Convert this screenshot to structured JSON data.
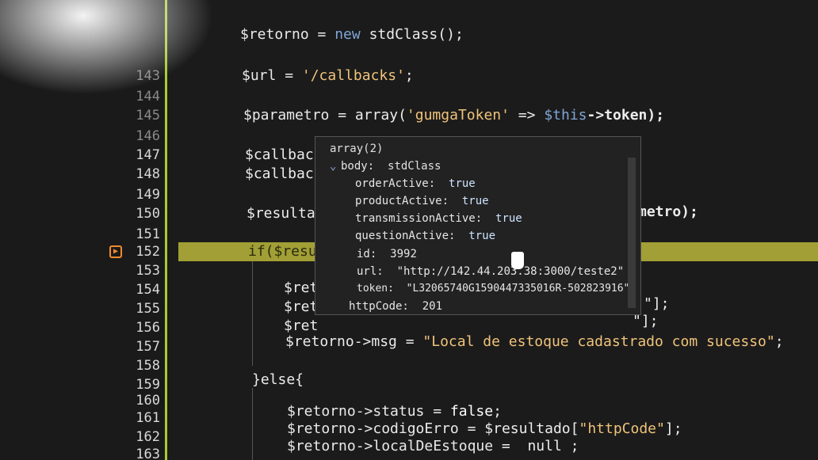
{
  "gutter": {
    "line_numbers": [
      "143",
      "144",
      "145",
      "146",
      "147",
      "148",
      "149",
      "150",
      "151",
      "152",
      "153",
      "154",
      "155",
      "156",
      "157",
      "158",
      "159",
      "160",
      "161",
      "162",
      "163"
    ]
  },
  "code": {
    "l_retorno_new": {
      "var": "$retorno",
      "op": " = ",
      "kw": "new",
      "rest": " stdClass();"
    },
    "l_url": {
      "var": "$url",
      "op": " = ",
      "str": "'/callbacks'",
      "end": ";"
    },
    "l_param": {
      "var": "$parametro",
      "op": " = ",
      "fn": "array(",
      "str": "'gumgaToken'",
      "arrow": " => ",
      "this": "$this",
      "prop": "->token);"
    },
    "l_callback1": "$callbac",
    "l_callback2": "$callbac",
    "l_resulta": "$resulta",
    "l_resulta_tail": "metro);",
    "l_if": "if($resu",
    "l_ret1": "$ret",
    "l_ret2": "$ret",
    "l_ret2_tail": "\"];",
    "l_ret3": "$ret",
    "l_ret3_tail": "\"];",
    "l_msg": {
      "var": "$retorno->msg",
      "op": " = ",
      "str": "\"Local de estoque cadastrado com sucesso\"",
      "end": ";"
    },
    "l_else": "}else{",
    "l_status": {
      "var": "$retorno->status",
      "op": " = ",
      "bool": "false",
      "end": ";"
    },
    "l_codigo": {
      "var": "$retorno->codigoErro",
      "op": " = ",
      "rest": "$resultado[",
      "str": "\"httpCode\"",
      "end": "];"
    },
    "l_local": {
      "var": "$retorno->localDeEstoque",
      "op": " =  ",
      "rest": "null ;"
    }
  },
  "tooltip": {
    "header": "array(2)",
    "body_key": "body:",
    "body_type": "stdClass",
    "props": [
      {
        "key": "orderActive:",
        "val": "true"
      },
      {
        "key": "productActive:",
        "val": "true"
      },
      {
        "key": "transmissionActive:",
        "val": "true"
      },
      {
        "key": "questionActive:",
        "val": "true"
      },
      {
        "key": "id:",
        "val": "3992"
      },
      {
        "key": "url:",
        "val": "\"http://142.44.203.38:3000/teste2\""
      },
      {
        "key": "token:",
        "val": "\"L32065740G1590447335016R-502823916\""
      }
    ],
    "http_key": "httpCode:",
    "http_val": "201"
  },
  "colors": {
    "gutter_accent": "#a8c934",
    "current_line": "#b9b63a",
    "breakpoint": "#f28a2a",
    "string": "#f0c37a",
    "keyword": "#7fa6d8"
  },
  "icons": {
    "breakpoint": "breakpoint-arrow-icon",
    "expand": "chevron-down-icon",
    "cursor": "hand-cursor-icon"
  }
}
